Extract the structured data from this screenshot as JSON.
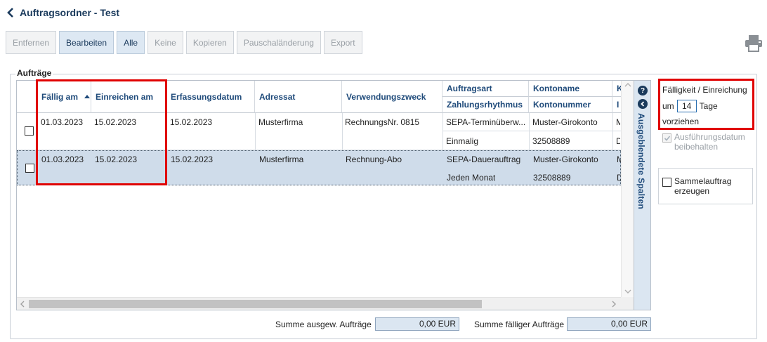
{
  "header": {
    "title": "Auftragsordner - Test"
  },
  "toolbar": {
    "entfernen": "Entfernen",
    "bearbeiten": "Bearbeiten",
    "alle": "Alle",
    "keine": "Keine",
    "kopieren": "Kopieren",
    "pauschal": "Pauschaländerung",
    "export": "Export"
  },
  "group": {
    "label": "Aufträge"
  },
  "table": {
    "headers": {
      "faellig": "Fällig am",
      "einreichen": "Einreichen am",
      "erfassung": "Erfassungsdatum",
      "adressat": "Adressat",
      "verwendung": "Verwendungszweck",
      "auftragsart": "Auftragsart",
      "zahlungsrhythmus": "Zahlungsrhythmus",
      "kontoname": "Kontoname",
      "kontonummer": "Kontonummer",
      "k_trunc": "K",
      "i_trunc": "I"
    },
    "rows": [
      {
        "faellig": "01.03.2023",
        "einreichen": "15.02.2023",
        "erfassung": "15.02.2023",
        "adressat": "Musterfirma",
        "verwendung": "RechnungsNr. 0815",
        "auftragsart": "SEPA-Terminüberw...",
        "zahlungsrhythmus": "Einmalig",
        "kontoname": "Muster-Girokonto",
        "kontonummer": "32508889",
        "k_trunc": "M",
        "i_trunc": "D"
      },
      {
        "faellig": "01.03.2023",
        "einreichen": "15.02.2023",
        "erfassung": "15.02.2023",
        "adressat": "Musterfirma",
        "verwendung": "Rechnung-Abo",
        "auftragsart": "SEPA-Dauerauftrag",
        "zahlungsrhythmus": "Jeden Monat",
        "kontoname": "Muster-Girokonto",
        "kontonummer": "32508889",
        "k_trunc": "M",
        "i_trunc": "D"
      }
    ],
    "hidden_columns_label": "Ausgeblendete Spalten"
  },
  "options": {
    "faelligkeit_title": "Fälligkeit / Einreichung",
    "um": "um",
    "tage_value": "14",
    "tage": "Tage",
    "vorziehen": "vorziehen",
    "ausfuehrung": "Ausführungsdatum beibehalten",
    "sammelauftrag": "Sammelauftrag erzeugen"
  },
  "footer": {
    "summe_ausgew_label": "Summe ausgew. Aufträge",
    "summe_ausgew_value": "0,00 EUR",
    "summe_faellig_label": "Summe fälliger Aufträge",
    "summe_faellig_value": "0,00 EUR"
  },
  "colors": {
    "accent": "#1e4a7a",
    "highlight": "#e00000",
    "selected_row": "#cfdcea"
  }
}
